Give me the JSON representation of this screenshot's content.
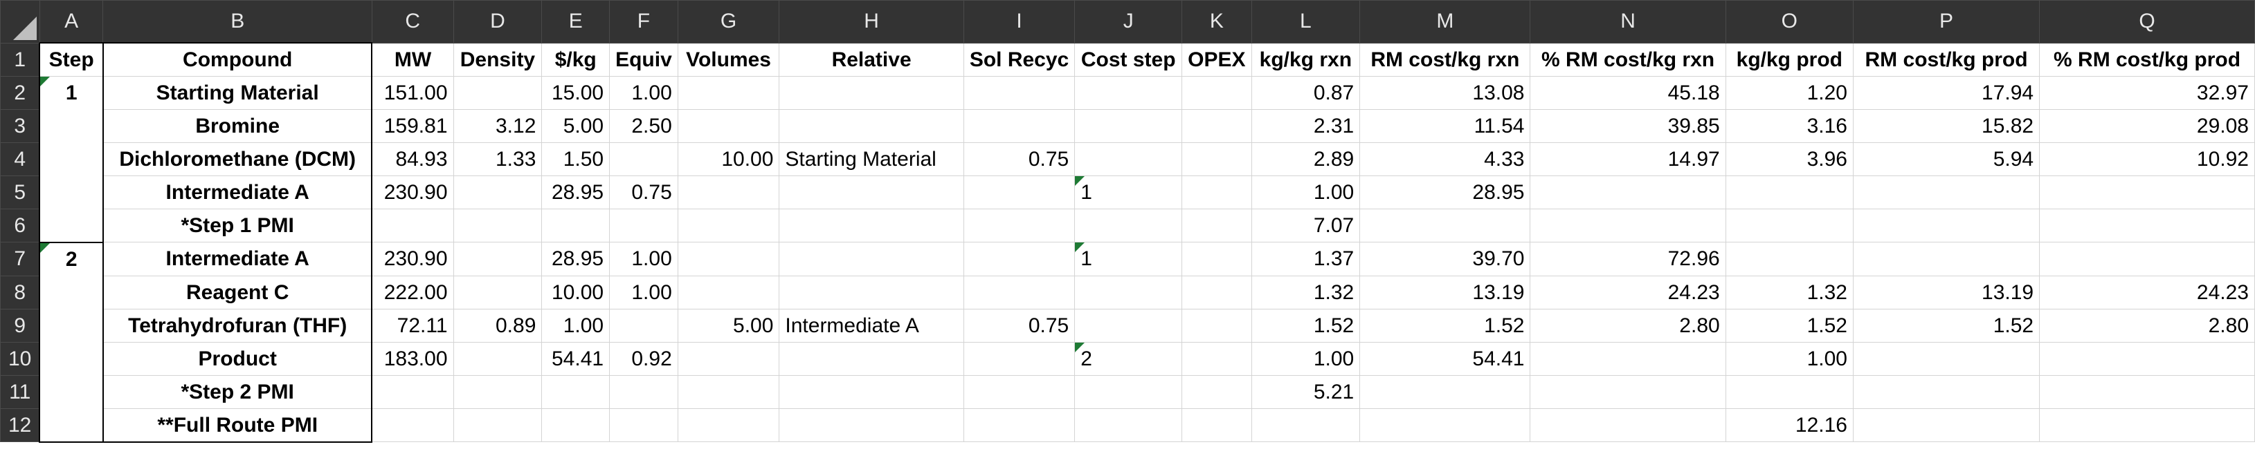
{
  "columns": [
    "A",
    "B",
    "C",
    "D",
    "E",
    "F",
    "G",
    "H",
    "I",
    "J",
    "K",
    "L",
    "M",
    "N",
    "O",
    "P",
    "Q"
  ],
  "headers": {
    "A": "Step",
    "B": "Compound",
    "C": "MW",
    "D": "Density",
    "E": "$/kg",
    "F": "Equiv",
    "G": "Volumes",
    "H": "Relative",
    "I": "Sol Recyc",
    "J": "Cost step",
    "K": "OPEX",
    "L": "kg/kg rxn",
    "M": "RM cost/kg rxn",
    "N": "% RM cost/kg rxn",
    "O": "kg/kg prod",
    "P": "RM cost/kg prod",
    "Q": "% RM cost/kg prod"
  },
  "rows": [
    {
      "num": "2",
      "A": "1",
      "B": "Starting Material",
      "C": "151.00",
      "D": "",
      "E": "15.00",
      "F": "1.00",
      "G": "",
      "H": "",
      "I": "",
      "J": "",
      "K": "",
      "L": "0.87",
      "M": "13.08",
      "N": "45.18",
      "O": "1.20",
      "P": "17.94",
      "Q": "32.97"
    },
    {
      "num": "3",
      "A": "",
      "B": "Bromine",
      "C": "159.81",
      "D": "3.12",
      "E": "5.00",
      "F": "2.50",
      "G": "",
      "H": "",
      "I": "",
      "J": "",
      "K": "",
      "L": "2.31",
      "M": "11.54",
      "N": "39.85",
      "O": "3.16",
      "P": "15.82",
      "Q": "29.08"
    },
    {
      "num": "4",
      "A": "",
      "B": "Dichloromethane (DCM)",
      "C": "84.93",
      "D": "1.33",
      "E": "1.50",
      "F": "",
      "G": "10.00",
      "H": "Starting Material",
      "I": "0.75",
      "J": "",
      "K": "",
      "L": "2.89",
      "M": "4.33",
      "N": "14.97",
      "O": "3.96",
      "P": "5.94",
      "Q": "10.92"
    },
    {
      "num": "5",
      "A": "",
      "B": "Intermediate A",
      "C": "230.90",
      "D": "",
      "E": "28.95",
      "F": "0.75",
      "G": "",
      "H": "",
      "I": "",
      "J": "1",
      "K": "",
      "L": "1.00",
      "M": "28.95",
      "N": "",
      "O": "",
      "P": "",
      "Q": ""
    },
    {
      "num": "6",
      "A": "",
      "B": "*Step 1 PMI",
      "C": "",
      "D": "",
      "E": "",
      "F": "",
      "G": "",
      "H": "",
      "I": "",
      "J": "",
      "K": "",
      "L": "7.07",
      "M": "",
      "N": "",
      "O": "",
      "P": "",
      "Q": ""
    },
    {
      "num": "7",
      "A": "2",
      "B": "Intermediate A",
      "C": "230.90",
      "D": "",
      "E": "28.95",
      "F": "1.00",
      "G": "",
      "H": "",
      "I": "",
      "J": "1",
      "K": "",
      "L": "1.37",
      "M": "39.70",
      "N": "72.96",
      "O": "",
      "P": "",
      "Q": ""
    },
    {
      "num": "8",
      "A": "",
      "B": "Reagent C",
      "C": "222.00",
      "D": "",
      "E": "10.00",
      "F": "1.00",
      "G": "",
      "H": "",
      "I": "",
      "J": "",
      "K": "",
      "L": "1.32",
      "M": "13.19",
      "N": "24.23",
      "O": "1.32",
      "P": "13.19",
      "Q": "24.23"
    },
    {
      "num": "9",
      "A": "",
      "B": "Tetrahydrofuran (THF)",
      "C": "72.11",
      "D": "0.89",
      "E": "1.00",
      "F": "",
      "G": "5.00",
      "H": "Intermediate A",
      "I": "0.75",
      "J": "",
      "K": "",
      "L": "1.52",
      "M": "1.52",
      "N": "2.80",
      "O": "1.52",
      "P": "1.52",
      "Q": "2.80"
    },
    {
      "num": "10",
      "A": "",
      "B": "Product",
      "C": "183.00",
      "D": "",
      "E": "54.41",
      "F": "0.92",
      "G": "",
      "H": "",
      "I": "",
      "J": "2",
      "K": "",
      "L": "1.00",
      "M": "54.41",
      "N": "",
      "O": "1.00",
      "P": "",
      "Q": ""
    },
    {
      "num": "11",
      "A": "",
      "B": "*Step 2 PMI",
      "C": "",
      "D": "",
      "E": "",
      "F": "",
      "G": "",
      "H": "",
      "I": "",
      "J": "",
      "K": "",
      "L": "5.21",
      "M": "",
      "N": "",
      "O": "",
      "P": "",
      "Q": ""
    },
    {
      "num": "12",
      "A": "",
      "B": "**Full Route PMI",
      "C": "",
      "D": "",
      "E": "",
      "F": "",
      "G": "",
      "H": "",
      "I": "",
      "J": "",
      "K": "",
      "L": "",
      "M": "",
      "N": "",
      "O": "12.16",
      "P": "",
      "Q": ""
    }
  ],
  "header_row_num": "1",
  "colors": {
    "header_bg": "#333333",
    "header_text": "#e8e8e8",
    "gridline": "#d4d4d4",
    "comment_marker": "#1e7a34"
  }
}
